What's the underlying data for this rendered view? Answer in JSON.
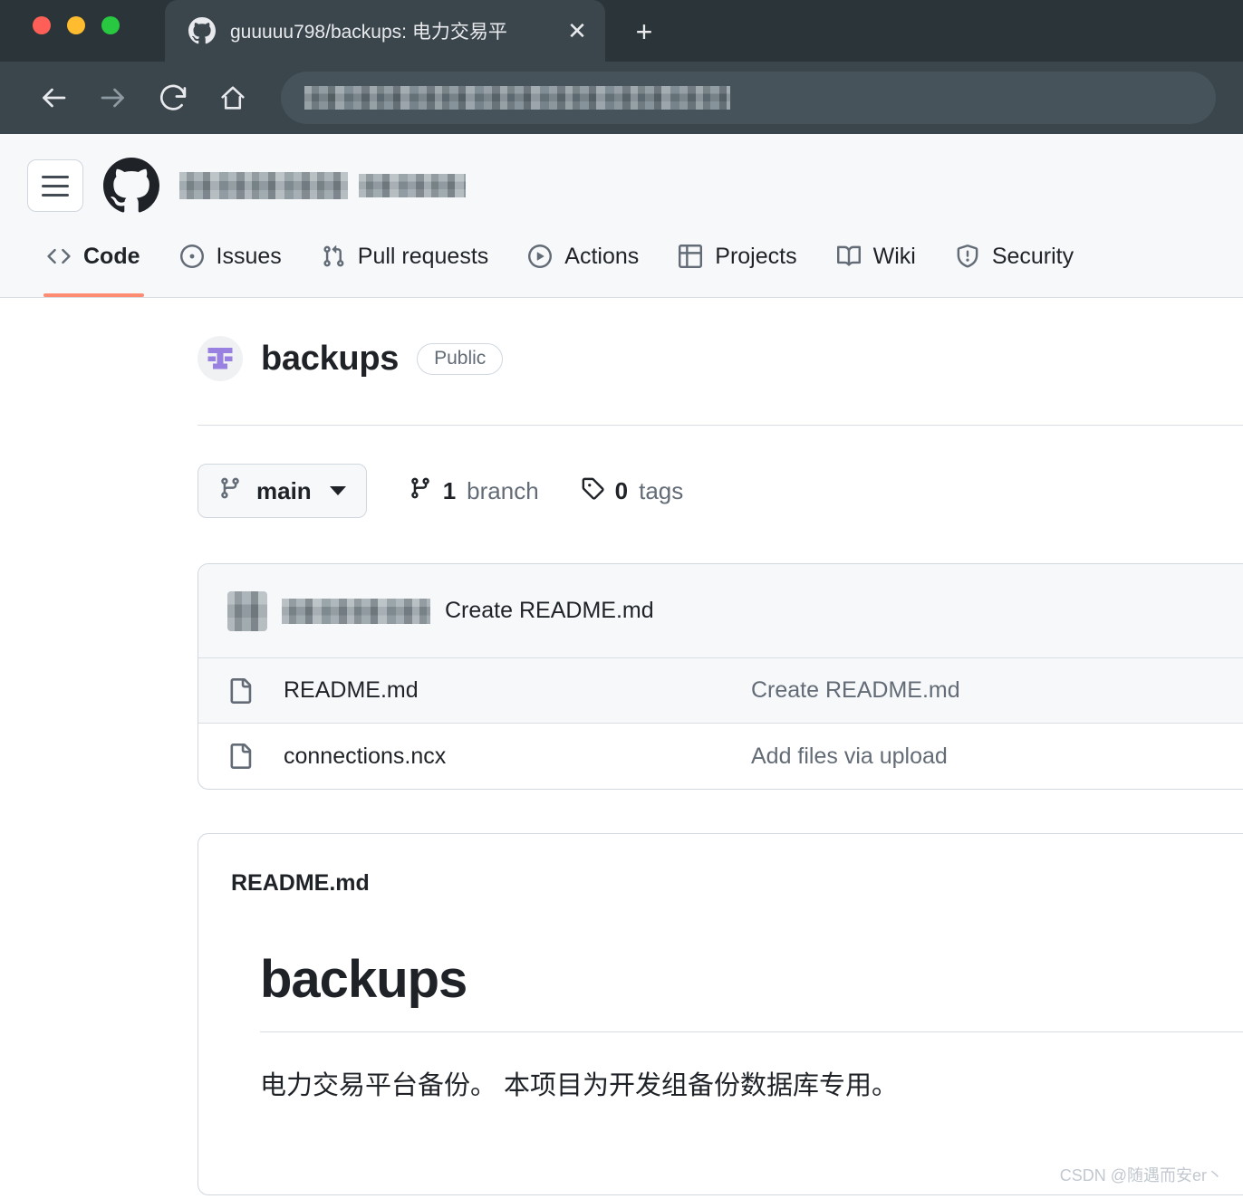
{
  "browser": {
    "tab": {
      "title": "guuuuu798/backups: 电力交易平",
      "favicon_icon": "github-mark-icon",
      "close_icon": "close-icon"
    },
    "new_tab_icon": "plus-icon",
    "toolbar": {
      "back_icon": "arrow-left-icon",
      "forward_icon": "arrow-right-icon",
      "reload_icon": "reload-icon",
      "home_icon": "home-icon",
      "url_value": "",
      "url_placeholder": ""
    },
    "colors": {
      "tab_strip_bg": "#2b3539",
      "toolbar_bg": "#3a454c",
      "active_tab_bg": "#3a454c",
      "url_field_bg": "#46535b",
      "traffic_red": "#ff5f57",
      "traffic_yellow": "#febc2e",
      "traffic_green": "#28c840"
    }
  },
  "gh_header": {
    "menu_icon": "hamburger-icon",
    "logo_icon": "github-mark-icon",
    "breadcrumb_owner": "",
    "breadcrumb_repo": "",
    "nav": [
      {
        "label": "Code",
        "icon": "code-icon",
        "active": true
      },
      {
        "label": "Issues",
        "icon": "issue-opened-icon",
        "active": false
      },
      {
        "label": "Pull requests",
        "icon": "git-pull-request-icon",
        "active": false
      },
      {
        "label": "Actions",
        "icon": "play-icon",
        "active": false
      },
      {
        "label": "Projects",
        "icon": "table-icon",
        "active": false
      },
      {
        "label": "Wiki",
        "icon": "book-icon",
        "active": false
      },
      {
        "label": "Security",
        "icon": "shield-icon",
        "active": false
      }
    ],
    "accent_underline": "#fd8c73"
  },
  "repo": {
    "avatar_icon": "repo-avatar-icon",
    "avatar_color": "#9881e0",
    "name": "backups",
    "visibility": "Public"
  },
  "branch_bar": {
    "branch_icon": "git-branch-icon",
    "branch_name": "main",
    "caret_icon": "chevron-down-icon",
    "branches_count": "1",
    "branches_label": "branch",
    "tags_icon": "tag-icon",
    "tags_count": "0",
    "tags_label": "tags"
  },
  "file_table": {
    "latest_commit": {
      "author": "",
      "message": "Create README.md",
      "avatar_icon": "user-avatar-icon"
    },
    "rows": [
      {
        "icon": "file-icon",
        "name": "README.md",
        "commit": "Create README.md"
      },
      {
        "icon": "file-icon",
        "name": "connections.ncx",
        "commit": "Add files via upload"
      }
    ]
  },
  "readme": {
    "filename": "README.md",
    "heading": "backups",
    "paragraph": "电力交易平台备份。 本项目为开发组备份数据库专用。"
  },
  "watermark": {
    "text": "CSDN @随遇而安er丶"
  }
}
